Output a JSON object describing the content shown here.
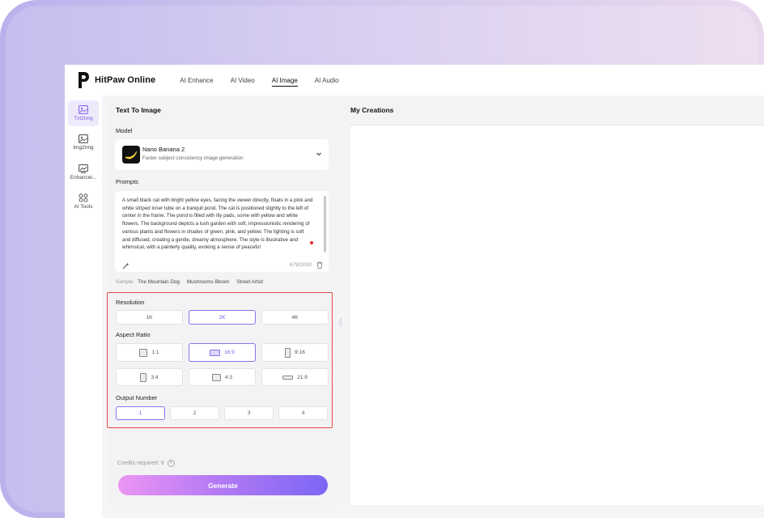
{
  "app": {
    "brand": "HitPaw Online",
    "nav": [
      "AI Enhance",
      "AI Video",
      "AI Image",
      "AI Audio"
    ],
    "active_nav": "AI Image"
  },
  "sidebar": {
    "items": [
      {
        "label": "Txt2Img",
        "icon": "image-text-icon",
        "active": true
      },
      {
        "label": "Img2Img",
        "icon": "image-convert-icon",
        "active": false
      },
      {
        "label": "Enhancel...",
        "icon": "image-enhance-icon",
        "active": false
      },
      {
        "label": "AI Tools",
        "icon": "grid-tools-icon",
        "active": false
      }
    ]
  },
  "panel": {
    "title": "Text To Image",
    "model_label": "Model",
    "model": {
      "name": "Nano Banana 2",
      "desc": "Faster subject consistency image generation"
    },
    "prompts_label": "Prompts",
    "prompt_text": "A small black cat with bright yellow eyes, facing the viewer directly, floats in a pink and white striped inner tube on a tranquil pond. The cat is positioned slightly to the left of center in the frame. The pond is filled with lily pads, some with yellow and white flowers. The background depicts a lush garden with soft, impressionistic rendering of various plants and flowers in shades of green, pink, and yellow. The lighting is soft and diffused, creating a gentle, dreamy atmosphere. The style is illustrative and whimsical, with a painterly quality, evoking a sense of peaceful",
    "char_count": "679/2000",
    "samples_label": "Sample:",
    "samples": [
      "The Mountain Dog",
      "Mushrooms Bloom",
      "Street Artist"
    ],
    "resolution_label": "Resolution",
    "resolutions": [
      "1K",
      "2K",
      "4K"
    ],
    "selected_resolution": "2K",
    "aspect_label": "Aspect Ratio",
    "aspect_ratios": [
      "1:1",
      "16:9",
      "9:16",
      "3:4",
      "4:3",
      "21:9"
    ],
    "selected_aspect": "16:9",
    "output_label": "Output Number",
    "outputs": [
      "1",
      "2",
      "3",
      "4"
    ],
    "selected_output": "1",
    "credits_text": "Credits required: 8",
    "help_glyph": "?",
    "generate_label": "Generate"
  },
  "creations": {
    "title": "My Creations"
  },
  "colors": {
    "accent": "#7b5cf0",
    "highlight_border": "#e54848",
    "generate_gradient": [
      "#ec95f4",
      "#7c66f5"
    ]
  }
}
